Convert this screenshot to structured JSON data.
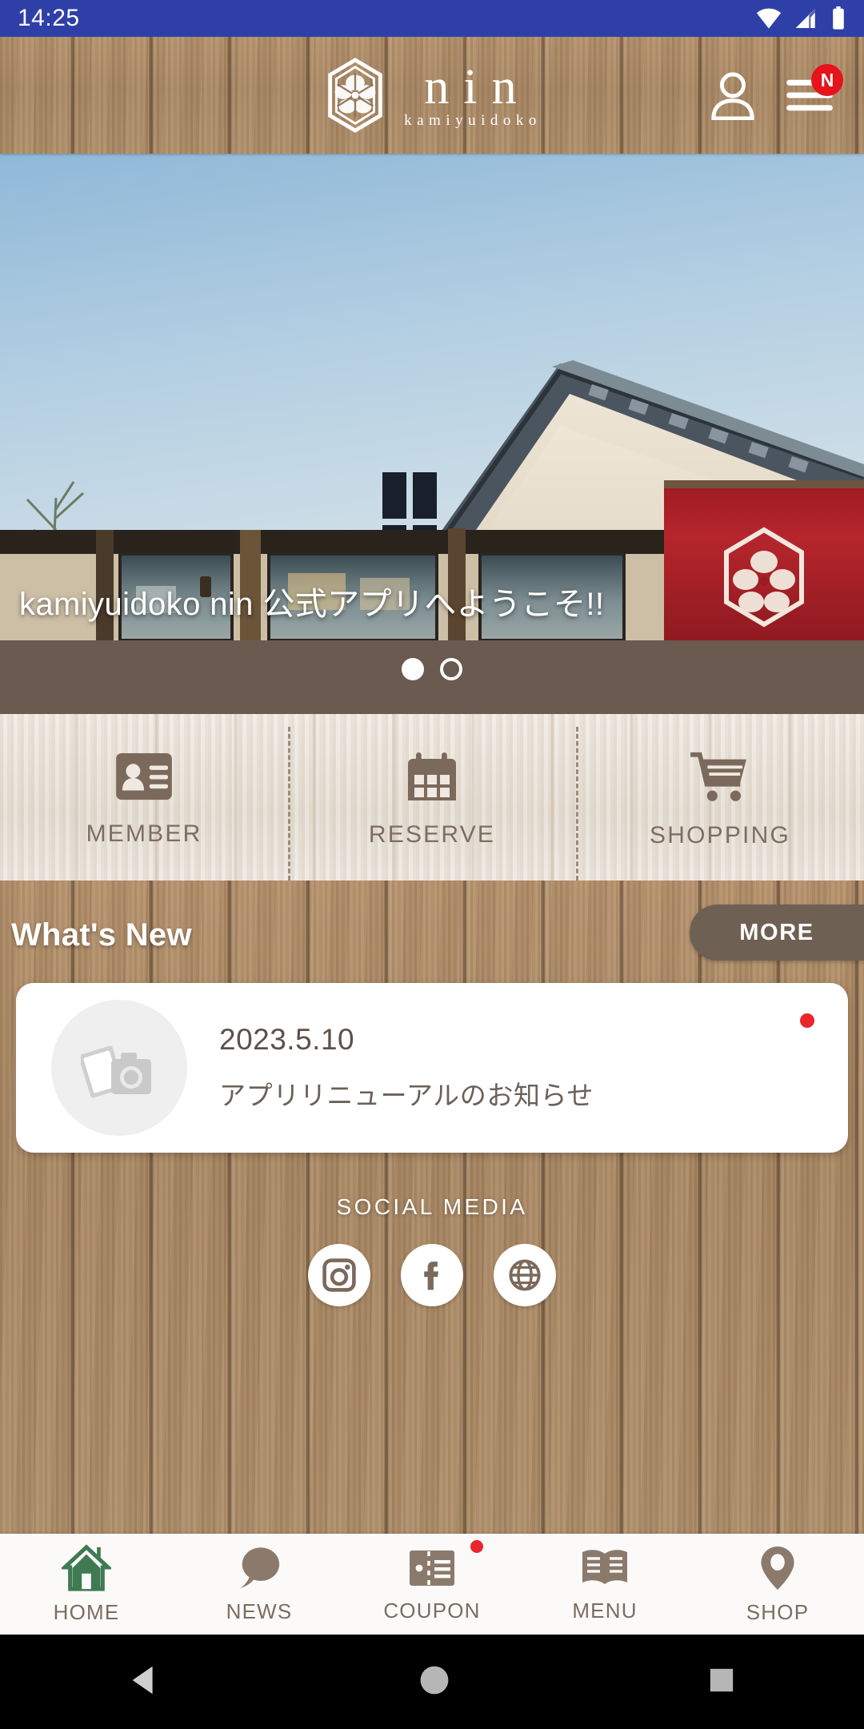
{
  "status_bar": {
    "clock": "14:25",
    "icons": [
      "wifi-icon",
      "cellular-signal-icon",
      "battery-icon"
    ],
    "background_color": "#2f3fa8"
  },
  "header": {
    "logo_word": "nin",
    "logo_subtitle": "kamiyuidoko",
    "logo_mark": "hexagon-flower-crest-icon",
    "account_icon": "person-icon",
    "menu_icon": "hamburger-menu-icon",
    "menu_badge": "N",
    "badge_color": "#e6131a"
  },
  "hero": {
    "caption": "kamiyuidoko nin 公式アプリへようこそ!!",
    "slide_count": 2,
    "active_slide": 1,
    "image_description": "traditional Japanese salon building with tiled roof and red noren curtain"
  },
  "quick_actions": [
    {
      "label": "MEMBER",
      "icon": "contact-card-icon"
    },
    {
      "label": "RESERVE",
      "icon": "calendar-icon"
    },
    {
      "label": "SHOPPING",
      "icon": "shopping-cart-icon"
    }
  ],
  "whats_new": {
    "title": "What's New",
    "more_label": "MORE",
    "items": [
      {
        "date": "2023.5.10",
        "title": "アプリリニューアルのお知らせ",
        "thumbnail_icon": "photo-placeholder-icon",
        "unread": true
      }
    ]
  },
  "social": {
    "title": "SOCIAL MEDIA",
    "links": [
      {
        "icon": "instagram-icon"
      },
      {
        "icon": "facebook-icon"
      },
      {
        "icon": "website-globe-icon"
      }
    ]
  },
  "tabbar": {
    "items": [
      {
        "label": "HOME",
        "icon": "home-icon",
        "active": true,
        "badge": false
      },
      {
        "label": "NEWS",
        "icon": "speech-bubble-icon",
        "active": false,
        "badge": false
      },
      {
        "label": "COUPON",
        "icon": "ticket-icon",
        "active": false,
        "badge": true
      },
      {
        "label": "MENU",
        "icon": "open-book-icon",
        "active": false,
        "badge": false
      },
      {
        "label": "SHOP",
        "icon": "map-pin-icon",
        "active": false,
        "badge": false
      }
    ],
    "active_color": "#3f7a52",
    "inactive_color": "#8b7a6c"
  },
  "android_nav": {
    "buttons": [
      "back-triangle-icon",
      "home-circle-icon",
      "recents-square-icon"
    ]
  },
  "theme": {
    "wood_dark": "#a98a68",
    "wood_light": "#e8e0d6",
    "accent_brown": "#6f6054",
    "text_brown": "#7d6e62"
  }
}
